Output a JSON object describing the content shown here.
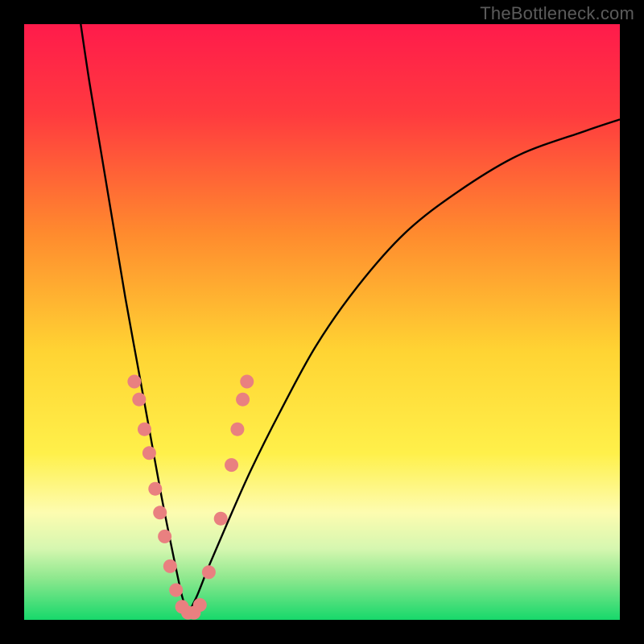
{
  "watermark": {
    "text": "TheBottleneck.com"
  },
  "colors": {
    "bg": "#000000",
    "curve": "#000000",
    "dot": "#e98080",
    "gradient_stops": [
      {
        "offset": 0.0,
        "color": "#ff1b4b"
      },
      {
        "offset": 0.15,
        "color": "#ff3a3f"
      },
      {
        "offset": 0.35,
        "color": "#ff8a2e"
      },
      {
        "offset": 0.55,
        "color": "#ffd433"
      },
      {
        "offset": 0.72,
        "color": "#fff04a"
      },
      {
        "offset": 0.82,
        "color": "#fdfcb0"
      },
      {
        "offset": 0.88,
        "color": "#d6f7b0"
      },
      {
        "offset": 0.93,
        "color": "#8ee88e"
      },
      {
        "offset": 1.0,
        "color": "#17d86b"
      }
    ]
  },
  "chart_data": {
    "type": "line",
    "title": "",
    "xlabel": "",
    "ylabel": "",
    "xlim": [
      0,
      100
    ],
    "ylim": [
      0,
      100
    ],
    "notes": "V-shaped bottleneck curve with apex ≈ x=27, y≈0. Dots highlight lower portion of both arms.",
    "series": [
      {
        "name": "left-arm",
        "x": [
          9.5,
          11,
          13,
          15,
          17,
          19,
          21,
          23,
          25,
          26.5,
          27.5
        ],
        "y": [
          100,
          90,
          78,
          66,
          54,
          43,
          32,
          21,
          11,
          4,
          1
        ]
      },
      {
        "name": "right-arm",
        "x": [
          27.5,
          29,
          31,
          34,
          38,
          43,
          49,
          56,
          64,
          73,
          83,
          94,
          100
        ],
        "y": [
          1,
          4,
          9,
          16,
          25,
          35,
          46,
          56,
          65,
          72,
          78,
          82,
          84
        ]
      }
    ],
    "highlight_dots": [
      {
        "x": 18.5,
        "y": 40
      },
      {
        "x": 19.3,
        "y": 37
      },
      {
        "x": 20.2,
        "y": 32
      },
      {
        "x": 21.0,
        "y": 28
      },
      {
        "x": 22.0,
        "y": 22
      },
      {
        "x": 22.8,
        "y": 18
      },
      {
        "x": 23.6,
        "y": 14
      },
      {
        "x": 24.5,
        "y": 9
      },
      {
        "x": 25.5,
        "y": 5
      },
      {
        "x": 26.5,
        "y": 2.2
      },
      {
        "x": 27.5,
        "y": 1.2
      },
      {
        "x": 28.5,
        "y": 1.2
      },
      {
        "x": 29.5,
        "y": 2.5
      },
      {
        "x": 31.0,
        "y": 8
      },
      {
        "x": 33.0,
        "y": 17
      },
      {
        "x": 34.8,
        "y": 26
      },
      {
        "x": 35.8,
        "y": 32
      },
      {
        "x": 36.7,
        "y": 37
      },
      {
        "x": 37.4,
        "y": 40
      }
    ]
  }
}
